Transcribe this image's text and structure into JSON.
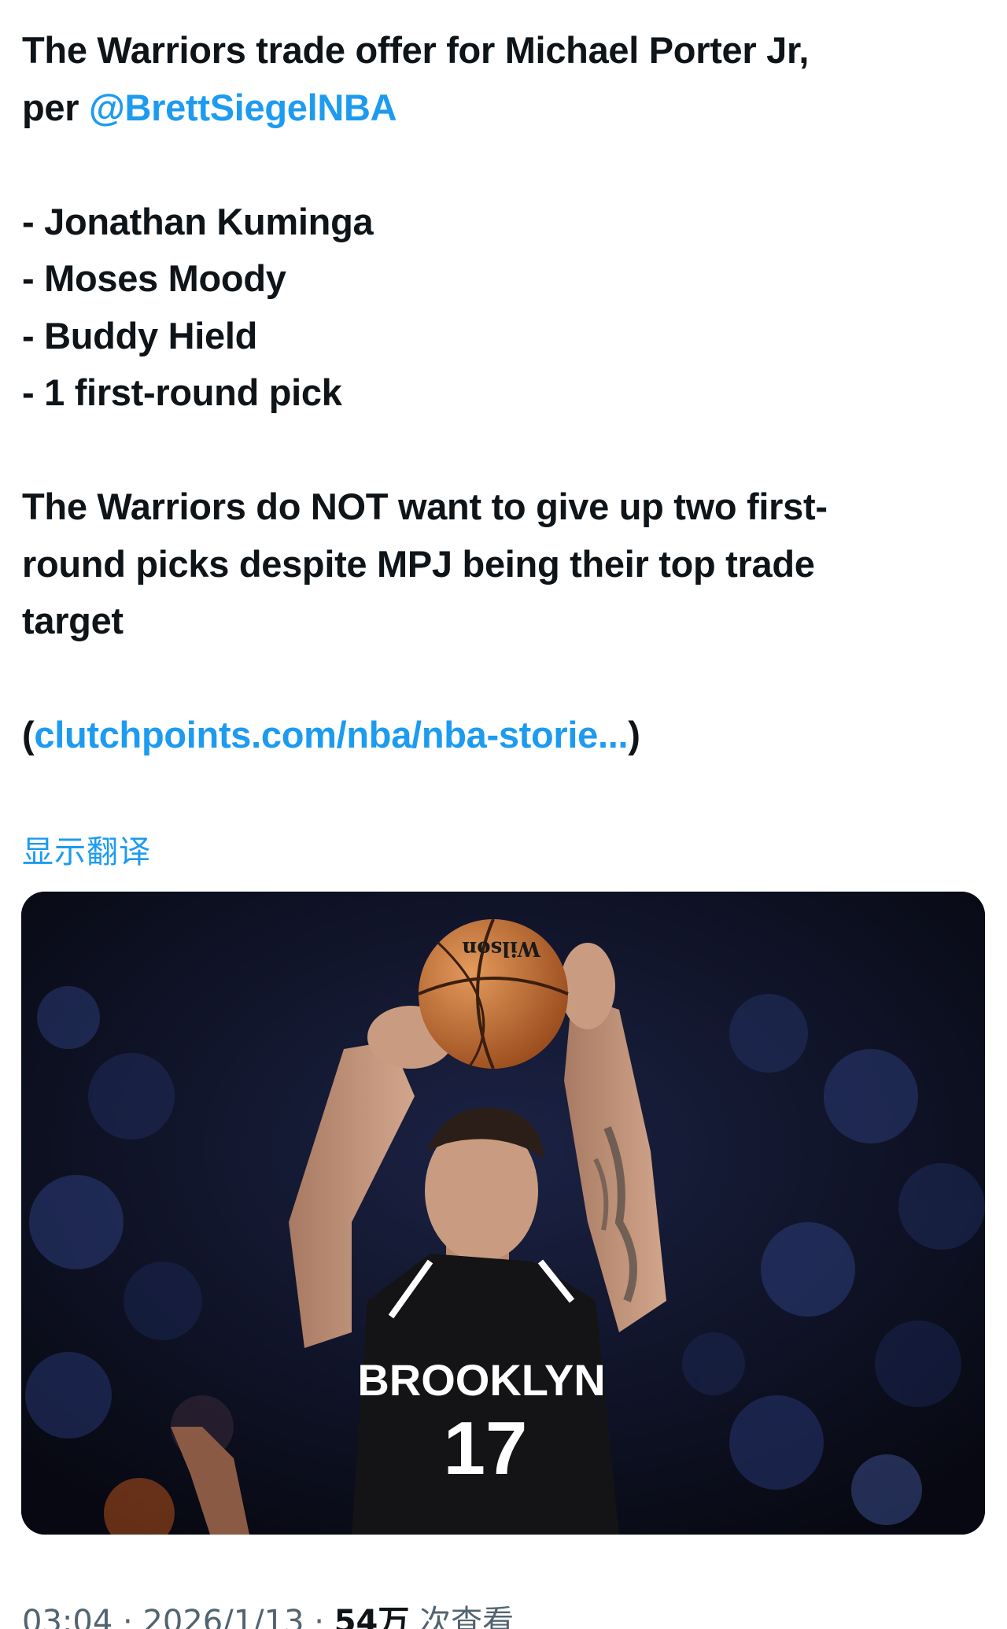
{
  "tweet": {
    "line1": "The Warriors trade offer for Michael Porter Jr,",
    "line2_prefix": "per ",
    "mention": "@BrettSiegelNBA",
    "list": [
      "- Jonathan Kuminga",
      "- Moses Moody",
      "- Buddy Hield",
      "- 1 first-round pick"
    ],
    "para_lines": [
      "The Warriors do NOT want to give up two first-",
      "round picks despite MPJ being their top trade",
      "target"
    ],
    "link_open": "(",
    "link_text": "clutchpoints.com/nba/nba-storie...",
    "link_close": ")"
  },
  "translate_label": "显示翻译",
  "media": {
    "jersey_team": "BROOKLYN",
    "jersey_number": "17",
    "ball_brand": "Wilson"
  },
  "meta": {
    "time": "03:04",
    "sep1": " · ",
    "date": "2026/1/13",
    "sep2": " · ",
    "views_num": "54万",
    "views_label": " 次查看"
  },
  "colors": {
    "accent": "#1d9bf0",
    "text": "#0f1419",
    "secondary": "#536471"
  }
}
